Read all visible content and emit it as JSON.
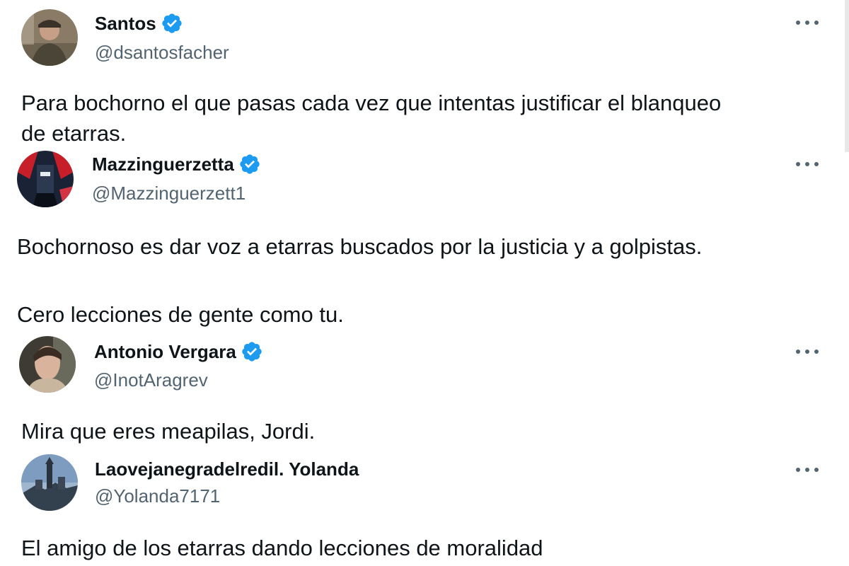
{
  "tweets": [
    {
      "name": "Santos",
      "handle": "@dsantosfacher",
      "verified": true,
      "avatar_icon": "user-avatar-photo",
      "lines": [
        "Para bochorno el que pasas cada vez que intentas justificar el blanqueo",
        "de etarras."
      ]
    },
    {
      "name": "Mazzinguerzetta",
      "handle": "@Mazzinguerzett1",
      "verified": true,
      "avatar_icon": "robot-avatar",
      "lines": [
        "Bochornoso es dar voz a etarras buscados por la justicia y a golpistas.",
        "",
        "Cero lecciones de gente como tu."
      ]
    },
    {
      "name": "Antonio Vergara",
      "handle": "@InotAragrev",
      "verified": true,
      "avatar_icon": "user-avatar-photo",
      "lines": [
        "Mira que eres meapilas, Jordi."
      ]
    },
    {
      "name": "Laovejanegradelredil. Yolanda",
      "handle": "@Yolanda7171",
      "verified": false,
      "avatar_icon": "landscape-avatar",
      "lines": [
        "El amigo de los etarras dando lecciones de moralidad"
      ]
    }
  ],
  "colors": {
    "verified_blue": "#1d9bf0",
    "text": "#0f1419",
    "secondary_text": "#536471",
    "more_icon": "#536471"
  },
  "icons": {
    "verified": "verified-badge-icon",
    "more": "more-options-icon"
  }
}
